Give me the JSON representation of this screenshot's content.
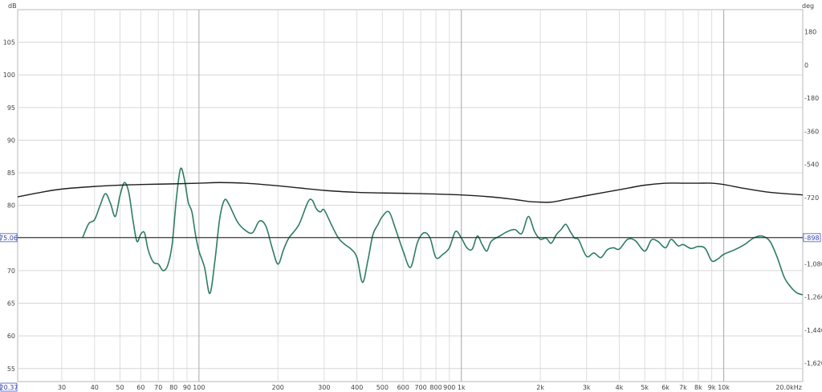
{
  "chart_data": {
    "type": "line",
    "title": "",
    "xlabel": "",
    "y_unit_left": "dB",
    "y_unit_right": "deg",
    "x_scale": "log",
    "x_range_hz": [
      20.37,
      20000
    ],
    "y_range_db": [
      53,
      110
    ],
    "y_right_range_deg": [
      -1720,
      300
    ],
    "grid": true,
    "x_ticks": [
      {
        "hz": 30,
        "label": "30"
      },
      {
        "hz": 40,
        "label": "40"
      },
      {
        "hz": 50,
        "label": "50"
      },
      {
        "hz": 60,
        "label": "60"
      },
      {
        "hz": 70,
        "label": "70"
      },
      {
        "hz": 80,
        "label": "80"
      },
      {
        "hz": 90,
        "label": "90"
      },
      {
        "hz": 100,
        "label": "100"
      },
      {
        "hz": 200,
        "label": "200"
      },
      {
        "hz": 300,
        "label": "300"
      },
      {
        "hz": 400,
        "label": "400"
      },
      {
        "hz": 500,
        "label": "500"
      },
      {
        "hz": 600,
        "label": "600"
      },
      {
        "hz": 700,
        "label": "700"
      },
      {
        "hz": 800,
        "label": "800"
      },
      {
        "hz": 900,
        "label": "900"
      },
      {
        "hz": 1000,
        "label": "1k"
      },
      {
        "hz": 2000,
        "label": "2k"
      },
      {
        "hz": 3000,
        "label": "3k"
      },
      {
        "hz": 4000,
        "label": "4k"
      },
      {
        "hz": 5000,
        "label": "5k"
      },
      {
        "hz": 6000,
        "label": "6k"
      },
      {
        "hz": 7000,
        "label": "7k"
      },
      {
        "hz": 8000,
        "label": "8k"
      },
      {
        "hz": 9000,
        "label": "9k"
      },
      {
        "hz": 10000,
        "label": "10k"
      },
      {
        "hz": 20000,
        "label": "20.0kHz"
      }
    ],
    "x_cursor_label": "20.37",
    "y_left_ticks": [
      {
        "value": 105,
        "label": "105"
      },
      {
        "value": 100,
        "label": "100"
      },
      {
        "value": 95,
        "label": "95"
      },
      {
        "value": 90,
        "label": "90"
      },
      {
        "value": 85,
        "label": "85"
      },
      {
        "value": 80,
        "label": "80"
      },
      {
        "value": 70,
        "label": "70"
      },
      {
        "value": 65,
        "label": "65"
      },
      {
        "value": 60,
        "label": "60"
      },
      {
        "value": 55,
        "label": "55"
      }
    ],
    "y_right_ticks": [
      {
        "value": 180,
        "label": "180"
      },
      {
        "value": 0,
        "label": "0"
      },
      {
        "value": -180,
        "label": "-180"
      },
      {
        "value": -360,
        "label": "-360"
      },
      {
        "value": -540,
        "label": "-540"
      },
      {
        "value": -720,
        "label": "-720"
      },
      {
        "value": -1080,
        "label": "-1,080"
      },
      {
        "value": -1260,
        "label": "-1,260"
      },
      {
        "value": -1440,
        "label": "-1,440"
      },
      {
        "value": -1620,
        "label": "-1,620"
      }
    ],
    "cursor": {
      "db": 75.06,
      "left_label": "75.06",
      "right_label": "-898"
    },
    "series": [
      {
        "color": "#2e7d60",
        "x": [
          36,
          38,
          40,
          42,
          44,
          46,
          48,
          50,
          52,
          54,
          56,
          58,
          60,
          62,
          64,
          67,
          70,
          73,
          76,
          79,
          82,
          85,
          88,
          91,
          94,
          97,
          100,
          105,
          110,
          115,
          120,
          125,
          130,
          140,
          150,
          160,
          170,
          180,
          190,
          200,
          210,
          220,
          240,
          260,
          270,
          280,
          290,
          300,
          320,
          340,
          360,
          380,
          400,
          420,
          440,
          460,
          480,
          500,
          530,
          560,
          600,
          640,
          680,
          720,
          760,
          800,
          850,
          900,
          950,
          1000,
          1050,
          1100,
          1150,
          1200,
          1250,
          1300,
          1400,
          1500,
          1600,
          1700,
          1800,
          1900,
          2000,
          2100,
          2200,
          2300,
          2400,
          2500,
          2600,
          2700,
          2800,
          3000,
          3200,
          3400,
          3600,
          3800,
          4000,
          4300,
          4600,
          5000,
          5300,
          5600,
          6000,
          6300,
          6700,
          7000,
          7500,
          8000,
          8500,
          9000,
          9500,
          10000,
          11000,
          12000,
          13000,
          14000,
          15000,
          16000,
          17000,
          18000,
          19000,
          20000
        ],
        "y": [
          75.0,
          77.2,
          77.8,
          80.0,
          81.8,
          80.3,
          78.3,
          81.5,
          83.5,
          82.0,
          77.8,
          74.5,
          75.6,
          75.8,
          73.2,
          71.3,
          71.0,
          70.0,
          70.8,
          74.0,
          81.0,
          85.6,
          84.0,
          80.5,
          79.0,
          75.5,
          73.0,
          70.5,
          66.5,
          71.5,
          78.0,
          80.8,
          80.2,
          77.5,
          76.2,
          75.8,
          77.6,
          76.8,
          73.5,
          71.0,
          73.2,
          75.0,
          77.0,
          80.5,
          80.8,
          79.5,
          79.0,
          79.3,
          77.0,
          75.0,
          74.0,
          73.3,
          72.0,
          68.2,
          71.5,
          75.5,
          77.0,
          78.3,
          79.0,
          76.5,
          73.0,
          70.5,
          74.3,
          75.8,
          75.0,
          72.0,
          72.5,
          73.5,
          76.0,
          75.0,
          73.5,
          73.3,
          75.3,
          74.0,
          73.0,
          74.5,
          75.3,
          76.0,
          76.3,
          75.7,
          78.3,
          76.0,
          74.8,
          75.0,
          74.2,
          75.5,
          76.3,
          77.1,
          76.0,
          75.0,
          74.7,
          72.2,
          72.7,
          72.0,
          73.2,
          73.5,
          73.3,
          74.8,
          74.6,
          73.0,
          74.7,
          74.5,
          73.5,
          74.8,
          73.8,
          74.0,
          73.4,
          73.7,
          73.4,
          71.5,
          71.8,
          72.5,
          73.2,
          74.0,
          75.0,
          75.3,
          74.5,
          72.0,
          69.0,
          67.5,
          66.6,
          66.3
        ]
      },
      {
        "color": "#1f1f1f",
        "x": [
          20.37,
          25,
          30,
          40,
          50,
          60,
          80,
          100,
          120,
          150,
          200,
          300,
          400,
          500,
          700,
          1000,
          1300,
          1600,
          1800,
          2000,
          2200,
          2500,
          3000,
          4000,
          5000,
          6000,
          7000,
          8000,
          9000,
          10000,
          12000,
          15000,
          20000
        ],
        "y": [
          81.3,
          82.0,
          82.5,
          82.9,
          83.1,
          83.2,
          83.3,
          83.4,
          83.5,
          83.4,
          83.0,
          82.3,
          82.0,
          81.9,
          81.8,
          81.6,
          81.3,
          80.9,
          80.6,
          80.5,
          80.5,
          80.9,
          81.5,
          82.4,
          83.1,
          83.4,
          83.4,
          83.4,
          83.4,
          83.2,
          82.6,
          82.0,
          81.6
        ]
      }
    ]
  }
}
